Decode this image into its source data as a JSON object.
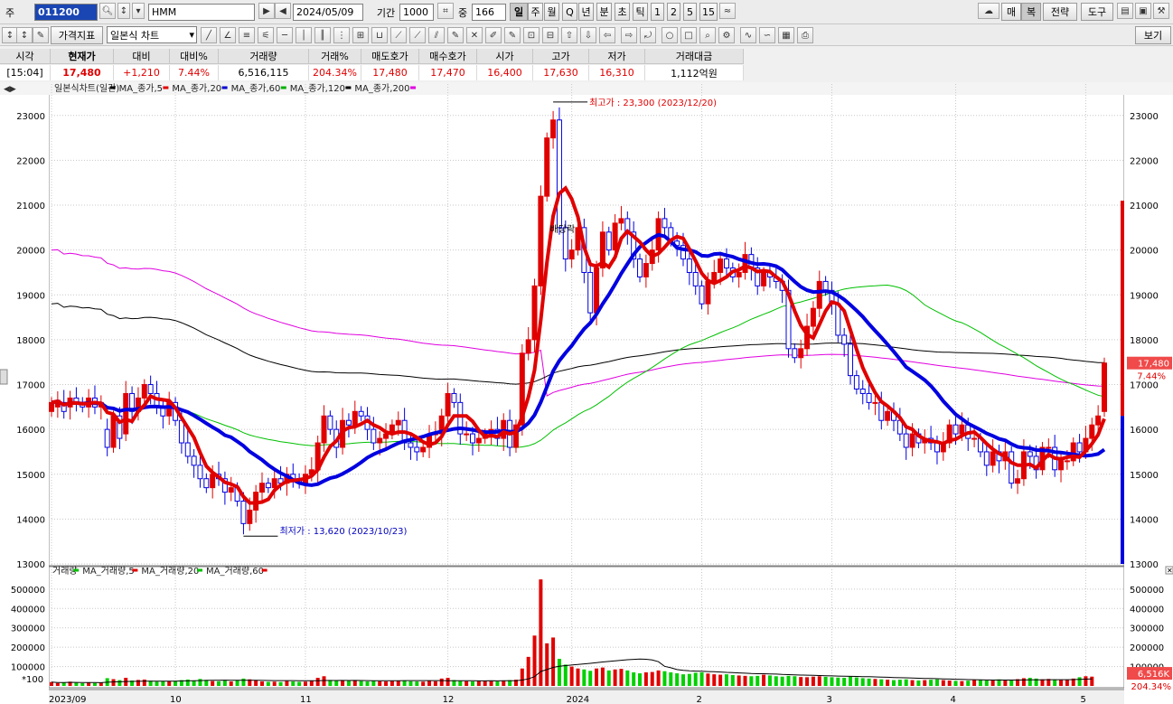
{
  "toolbar": {
    "market_label": "주",
    "stock_code": "011200",
    "stock_name": "HMM",
    "date": "2024/05/09",
    "period_label": "기간",
    "period_value": "1000",
    "count_label": "중",
    "count_value": "166",
    "periods": [
      "일",
      "주",
      "월",
      "Q",
      "년",
      "분",
      "초",
      "틱",
      "1",
      "2",
      "5",
      "15"
    ],
    "right_buttons": [
      "매",
      "복",
      "전략",
      "도구"
    ],
    "row2_menus": [
      "가격지표",
      "일본식 차트"
    ],
    "view_label": "보기"
  },
  "quote": {
    "headers": [
      "시각",
      "현재가",
      "대비",
      "대비%",
      "거래량",
      "거래%",
      "매도호가",
      "매수호가",
      "시가",
      "고가",
      "저가",
      "거래대금"
    ],
    "values": [
      "[15:04]",
      "17,480",
      "+1,210",
      "7.44%",
      "6,516,115",
      "204.34%",
      "17,480",
      "17,470",
      "16,400",
      "17,630",
      "16,310",
      "1,112억원"
    ]
  },
  "legend_main": [
    {
      "text": "일본식차트(일간)",
      "color": "#000000"
    },
    {
      "text": "MA_종가,5",
      "color": "#e00000"
    },
    {
      "text": "MA_종가,20",
      "color": "#0000d0"
    },
    {
      "text": "MA_종가,60",
      "color": "#00b000"
    },
    {
      "text": "MA_종가,120",
      "color": "#000000"
    },
    {
      "text": "MA_종가,200",
      "color": "#e000e0"
    }
  ],
  "legend_vol": [
    {
      "text": "거래량",
      "color": "#000000"
    },
    {
      "text": "MA_거래량,5",
      "color": "#e00000"
    },
    {
      "text": "MA_거래량,20",
      "color": "#000000"
    },
    {
      "text": "MA_거래량,60",
      "color": "#e00000"
    }
  ],
  "annotations": {
    "high": "최고가 : 23,300 (2023/12/20)",
    "low": "최저가 : 13,620 (2023/10/23)",
    "dividend": "배당락"
  },
  "price_tag": "17,480",
  "change_tag": "7.44%",
  "vol_tag": "6,516K",
  "vol_pct_tag": "204.34%",
  "vol_unit": "*100",
  "chart_data": {
    "type": "candlestick",
    "colors": {
      "up": "#e00000",
      "down": "#0000e0",
      "ma5": "#e00000",
      "ma20": "#0000e0",
      "ma60": "#00c000",
      "ma120": "#000000",
      "ma200": "#e000e0"
    },
    "ylim": [
      13000,
      23500
    ],
    "y_ticks": [
      13000,
      14000,
      15000,
      16000,
      17000,
      18000,
      19000,
      20000,
      21000,
      22000,
      23000
    ],
    "vol_ylim": [
      0,
      560000
    ],
    "vol_ticks": [
      100000,
      200000,
      300000,
      400000,
      500000
    ],
    "x_month_labels": [
      {
        "i": 0,
        "label": "2023/09"
      },
      {
        "i": 20,
        "label": "10"
      },
      {
        "i": 41,
        "label": "11"
      },
      {
        "i": 64,
        "label": "12"
      },
      {
        "i": 84,
        "label": "2024"
      },
      {
        "i": 105,
        "label": "2"
      },
      {
        "i": 126,
        "label": "3"
      },
      {
        "i": 146,
        "label": "4"
      },
      {
        "i": 167,
        "label": "5"
      }
    ],
    "close": [
      16600,
      16650,
      16400,
      16700,
      16600,
      16500,
      16700,
      16500,
      16600,
      15600,
      16300,
      15800,
      16800,
      16400,
      16700,
      17000,
      16800,
      16500,
      16300,
      16600,
      16200,
      15700,
      15400,
      15200,
      14900,
      14700,
      15000,
      14900,
      14600,
      14700,
      14400,
      13900,
      14200,
      14600,
      14800,
      14700,
      14900,
      14800,
      15000,
      14900,
      14800,
      15000,
      15100,
      15700,
      16300,
      16000,
      15600,
      16200,
      16100,
      16400,
      16300,
      16000,
      15700,
      15800,
      15900,
      16100,
      16200,
      15700,
      15600,
      15500,
      15600,
      15900,
      15900,
      16300,
      16800,
      16600,
      15900,
      15900,
      15700,
      15800,
      15900,
      16000,
      15800,
      16200,
      15600,
      16100,
      17700,
      18000,
      19200,
      21200,
      22500,
      22900,
      20500,
      19800,
      20000,
      20500,
      19500,
      18600,
      19600,
      20400,
      20000,
      20600,
      20700,
      20400,
      19800,
      19400,
      19700,
      20000,
      20700,
      20500,
      20200,
      20100,
      19800,
      19500,
      19200,
      18800,
      19300,
      19500,
      19800,
      19600,
      19400,
      19500,
      19900,
      19600,
      19200,
      19500,
      19400,
      19300,
      19100,
      17800,
      17600,
      17800,
      18300,
      18700,
      19300,
      19100,
      18800,
      18100,
      17900,
      17200,
      16900,
      16800,
      16600,
      16600,
      16200,
      16400,
      16200,
      15900,
      15600,
      15900,
      15700,
      15800,
      15700,
      15500,
      15700,
      16100,
      15900,
      16100,
      15800,
      15800,
      15500,
      15200,
      15500,
      15300,
      15500,
      14800,
      14900,
      15500,
      15400,
      15100,
      15600,
      15600,
      15100,
      15300,
      15300,
      15700,
      15500,
      15800,
      16100,
      16300,
      17480
    ],
    "open": [
      16400,
      16500,
      16600,
      16500,
      16700,
      16600,
      16500,
      16700,
      16500,
      16000,
      15600,
      16300,
      15900,
      16800,
      16400,
      16700,
      17000,
      16800,
      16500,
      16300,
      16600,
      16200,
      15700,
      15400,
      15200,
      14900,
      14700,
      15000,
      14900,
      14600,
      14700,
      14400,
      13900,
      14200,
      14600,
      14800,
      14700,
      14900,
      14800,
      15000,
      14900,
      14800,
      15000,
      15100,
      15700,
      16300,
      16000,
      15600,
      16200,
      16100,
      16400,
      16300,
      16000,
      15700,
      15800,
      15900,
      16100,
      16200,
      15700,
      15600,
      15500,
      15600,
      15900,
      15900,
      16300,
      16800,
      16600,
      15900,
      15900,
      15700,
      15800,
      15900,
      16000,
      15800,
      16200,
      15600,
      16100,
      17700,
      18000,
      19200,
      21200,
      22500,
      22900,
      20500,
      19800,
      20000,
      20500,
      19500,
      18600,
      19600,
      20400,
      20000,
      20600,
      20700,
      20400,
      19800,
      19400,
      19700,
      20000,
      20700,
      20500,
      20200,
      20100,
      19800,
      19500,
      19200,
      18800,
      19300,
      19500,
      19800,
      19600,
      19400,
      19500,
      19900,
      19600,
      19200,
      19500,
      19400,
      19300,
      19100,
      17800,
      17600,
      17800,
      18300,
      18700,
      19300,
      19100,
      18800,
      18100,
      17900,
      17200,
      16900,
      16800,
      16600,
      16600,
      16200,
      16400,
      16200,
      15900,
      15600,
      15900,
      15700,
      15800,
      15700,
      15500,
      15700,
      16100,
      15900,
      16100,
      15800,
      15800,
      15500,
      15200,
      15500,
      15300,
      15500,
      14800,
      14900,
      15500,
      15400,
      15100,
      15600,
      15600,
      15100,
      15300,
      15300,
      15700,
      15500,
      15800,
      16100,
      16400
    ],
    "volume_hundreds": [
      200,
      150,
      180,
      220,
      160,
      140,
      170,
      150,
      160,
      400,
      350,
      300,
      420,
      280,
      310,
      330,
      270,
      220,
      250,
      240,
      260,
      300,
      330,
      280,
      360,
      310,
      250,
      240,
      270,
      230,
      300,
      380,
      340,
      290,
      230,
      210,
      220,
      200,
      250,
      230,
      210,
      220,
      260,
      420,
      500,
      310,
      280,
      300,
      260,
      270,
      250,
      230,
      260,
      240,
      230,
      250,
      260,
      280,
      240,
      230,
      220,
      260,
      240,
      380,
      420,
      300,
      250,
      240,
      230,
      260,
      250,
      240,
      230,
      280,
      300,
      320,
      900,
      1500,
      2600,
      5500,
      2200,
      2500,
      1400,
      1100,
      1000,
      900,
      850,
      780,
      900,
      950,
      800,
      850,
      880,
      800,
      700,
      650,
      700,
      720,
      800,
      760,
      700,
      650,
      600,
      620,
      680,
      700,
      640,
      600,
      580,
      600,
      560,
      540,
      520,
      500,
      520,
      580,
      540,
      500,
      480,
      520,
      500,
      460,
      450,
      480,
      500,
      470,
      450,
      430,
      420,
      480,
      440,
      400,
      380,
      360,
      340,
      320,
      300,
      320,
      340,
      300,
      280,
      300,
      320,
      340,
      300,
      280,
      260,
      250,
      270,
      300,
      320,
      280,
      300,
      340,
      300,
      320,
      350,
      400,
      420,
      380,
      340,
      360,
      330,
      300,
      320,
      380,
      450,
      500,
      480
    ]
  }
}
